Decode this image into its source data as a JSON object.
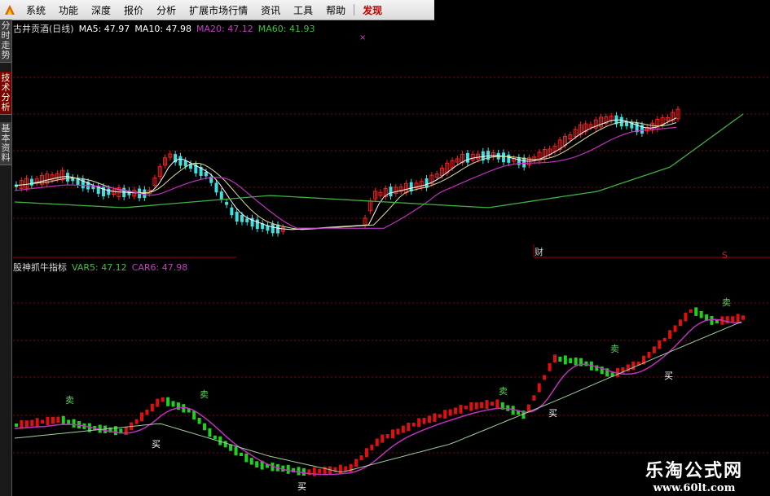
{
  "menu": {
    "items": [
      {
        "label": "系统",
        "name": "menu-system"
      },
      {
        "label": "功能",
        "name": "menu-function"
      },
      {
        "label": "深度",
        "name": "menu-depth"
      },
      {
        "label": "报价",
        "name": "menu-quote"
      },
      {
        "label": "分析",
        "name": "menu-analysis"
      },
      {
        "label": "扩展市场行情",
        "name": "menu-extended-market"
      },
      {
        "label": "资讯",
        "name": "menu-news"
      },
      {
        "label": "工具",
        "name": "menu-tools"
      },
      {
        "label": "帮助",
        "name": "menu-help"
      }
    ],
    "special": {
      "label": "发现",
      "name": "menu-discover"
    }
  },
  "side_tabs": [
    {
      "label": "分时走势",
      "active": false
    },
    {
      "label": "技术分析",
      "active": true
    },
    {
      "label": "基本资料",
      "active": false
    }
  ],
  "top_panel": {
    "title": "古井贡酒(日线)",
    "legend": [
      {
        "label": "MA5: 47.97",
        "color": "#ffffff"
      },
      {
        "label": "MA10: 47.98",
        "color": "#ffffff"
      },
      {
        "label": "MA20: 47.12",
        "color": "#c040c0"
      },
      {
        "label": "MA60: 41.93",
        "color": "#40c040"
      }
    ],
    "marker": "财",
    "marker_s": "S"
  },
  "bottom_panel": {
    "title": "股神抓牛指标",
    "legend": [
      {
        "label": "VAR5: 47.12",
        "color": "#40c040"
      },
      {
        "label": "CAR6: 47.98",
        "color": "#c040c0"
      }
    ],
    "signals": [
      {
        "text": "卖"
      },
      {
        "text": "买"
      },
      {
        "text": "卖"
      },
      {
        "text": "买"
      },
      {
        "text": "卖"
      },
      {
        "text": "买"
      },
      {
        "text": "卖"
      },
      {
        "text": "买"
      },
      {
        "text": "卖"
      }
    ]
  },
  "watermark": {
    "title": "乐淘公式网",
    "url": "www.60lt.com"
  },
  "colors": {
    "up": "#ff2020",
    "down": "#40e0e0",
    "bar_up": "#e01010",
    "bar_down": "#20d020",
    "ma_white": "#ffffff",
    "ma_purple": "#c030c0",
    "ma_green": "#40b040",
    "grid": "#8a0000"
  }
}
